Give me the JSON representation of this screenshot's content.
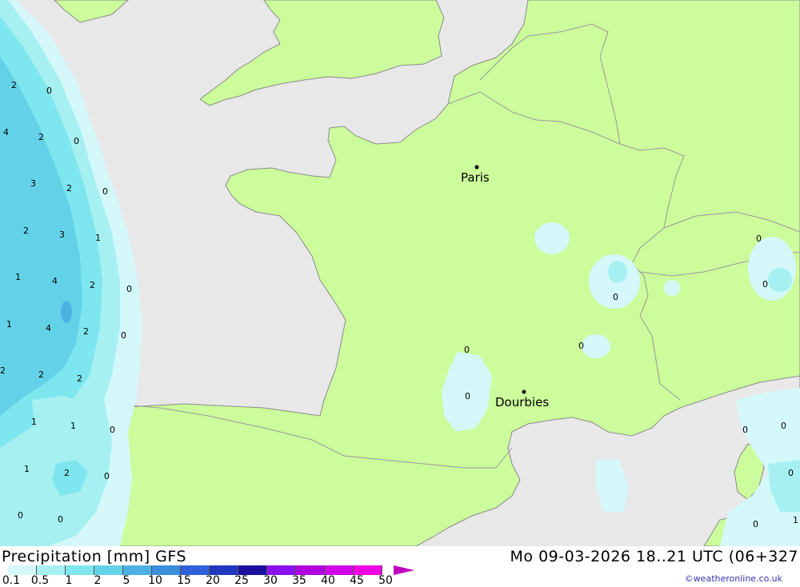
{
  "header": {
    "title_left": "Precipitation [mm] GFS",
    "title_right": "Mo 09-03-2026 18..21 UTC (06+327"
  },
  "legend": {
    "labels": [
      "0.1",
      "0.5",
      "1",
      "2",
      "5",
      "10",
      "15",
      "20",
      "25",
      "30",
      "35",
      "40",
      "45",
      "50"
    ],
    "colors": [
      "#d4f8fa",
      "#a6f0f2",
      "#7ee6ee",
      "#63d2e8",
      "#4cb2e3",
      "#3b8fdc",
      "#3060d8",
      "#2038c0",
      "#1a10a0",
      "#8a10ee",
      "#b000e0",
      "#d000e8",
      "#f000e0",
      "#c000c0"
    ]
  },
  "credit": "©weatheronline.co.uk",
  "map": {
    "colors": {
      "sea": "#e8e8e8",
      "land": "#ccfc9c",
      "border": "#999999",
      "coast": "#8a8a8a",
      "light_precip": "#d4f8fa",
      "mid_precip": "#a6f0f2",
      "heavy_precip": "#63d2e8"
    },
    "cities": [
      {
        "name": "Paris"
      },
      {
        "name": "Dourbies"
      }
    ],
    "values": [
      "2",
      "0",
      "4",
      "2",
      "0",
      "3",
      "2",
      "0",
      "2",
      "3",
      "1",
      "1",
      "4",
      "2",
      "0",
      "1",
      "4",
      "2",
      "0",
      "2",
      "2",
      "2",
      "1",
      "1",
      "0",
      "1",
      "2",
      "0",
      "0",
      "0",
      "0",
      "0",
      "0",
      "0",
      "0",
      "0",
      "0",
      "0",
      "0",
      "0",
      "1"
    ]
  }
}
